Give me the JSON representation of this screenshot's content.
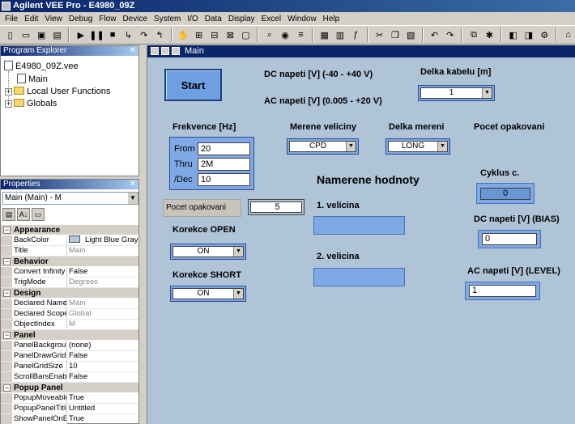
{
  "window": {
    "title": "Agilent VEE Pro - E4980_09Z"
  },
  "menu": [
    "File",
    "Edit",
    "View",
    "Debug",
    "Flow",
    "Device",
    "System",
    "I/O",
    "Data",
    "Display",
    "Excel",
    "Window",
    "Help"
  ],
  "program_explorer": {
    "title": "Program Explorer",
    "file": "E4980_09Z.vee",
    "items": [
      "Main",
      "Local User Functions",
      "Globals"
    ]
  },
  "properties": {
    "title": "Properties",
    "selected": "Main (Main) - M",
    "categories": [
      {
        "name": "Appearance",
        "rows": [
          {
            "name": "BackColor",
            "value": "Light Blue Gray",
            "swatch": "#b5c9dd"
          },
          {
            "name": "Title",
            "value": "Main"
          }
        ]
      },
      {
        "name": "Behavior",
        "rows": [
          {
            "name": "Convert Infinity t",
            "value": "False"
          },
          {
            "name": "TrigMode",
            "value": "Degrees"
          }
        ]
      },
      {
        "name": "Design",
        "rows": [
          {
            "name": "Declared Name",
            "value": "Main"
          },
          {
            "name": "Declared Scope",
            "value": "Global"
          },
          {
            "name": "ObjectIndex",
            "value": "M"
          }
        ]
      },
      {
        "name": "Panel",
        "rows": [
          {
            "name": "PanelBackgrour",
            "value": "(none)"
          },
          {
            "name": "PanelDrawGrid",
            "value": "False"
          },
          {
            "name": "PanelGridSize",
            "value": "10"
          },
          {
            "name": "ScrollBarsEnable",
            "value": "False"
          }
        ]
      },
      {
        "name": "Popup Panel",
        "rows": [
          {
            "name": "PopupMoveable",
            "value": "True"
          },
          {
            "name": "PopupPanelTitle",
            "value": "Untitled"
          },
          {
            "name": "ShowPanelOnE",
            "value": "True"
          }
        ]
      }
    ]
  },
  "main": {
    "title": "Main",
    "start_label": "Start",
    "dc_label": "DC napeti [V] (-40 - +40 V)",
    "ac_label": "AC napeti [V] (0.005 - +20 V)",
    "cable_label": "Delka kabelu [m]",
    "cable_value": "1",
    "freq_label": "Frekvence [Hz]",
    "from_label": "From",
    "from_value": "20",
    "thru_label": "Thru",
    "thru_value": "2M",
    "dec_label": "/Dec",
    "dec_value": "10",
    "merene_label": "Merene veliciny",
    "merene_value": "CPD",
    "delka_mereni_label": "Delka mereni",
    "delka_mereni_value": "LONG",
    "pocet_header": "Pocet opakovani",
    "pocet_label": "Pocet opakovani",
    "pocet_value": "5",
    "namerene_label": "Namerene hodnoty",
    "velicina1_label": "1. velicina",
    "velicina2_label": "2. velicina",
    "cyklus_label": "Cyklus c.",
    "cyklus_value": "0",
    "dc_bias_label": "DC napeti [V] (BIAS)",
    "dc_bias_value": "0",
    "ac_level_label": "AC napeti [V] (LEVEL)",
    "ac_level_value": "1",
    "korekce_open_label": "Korekce OPEN",
    "korekce_open_value": "ON",
    "korekce_short_label": "Korekce SHORT",
    "korekce_short_value": "ON"
  }
}
